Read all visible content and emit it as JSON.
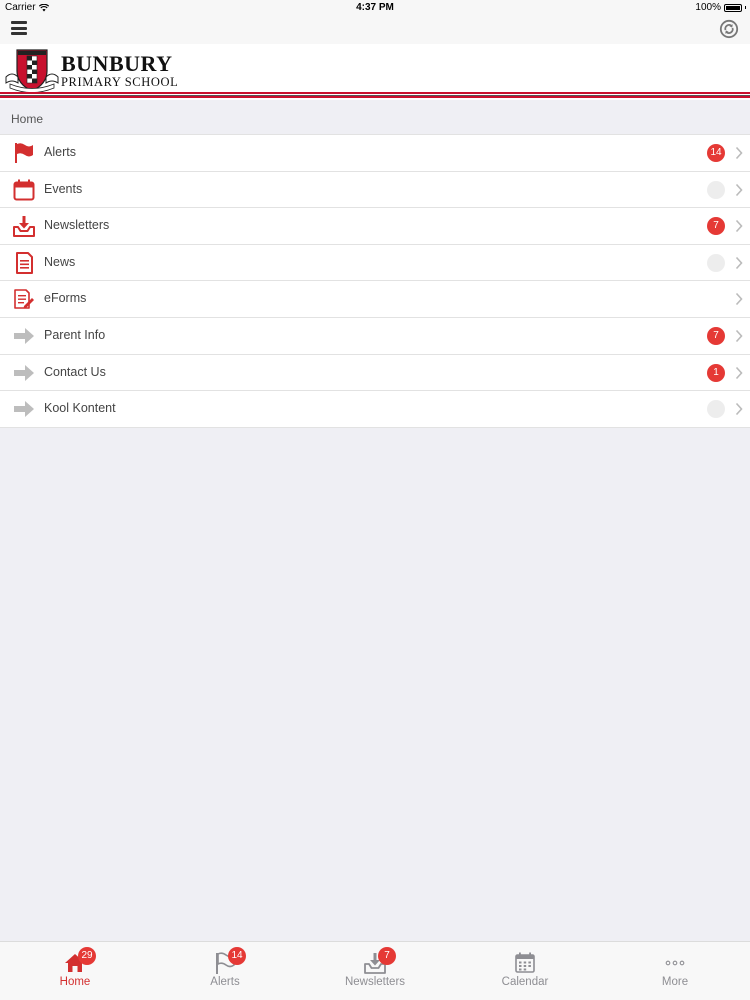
{
  "status_bar": {
    "carrier": "Carrier",
    "time": "4:37 PM",
    "battery": "100%"
  },
  "header": {
    "school_line1": "BUNBURY",
    "school_line2": "PRIMARY SCHOOL"
  },
  "breadcrumb": "Home",
  "menu": [
    {
      "label": "Alerts",
      "badge": "14",
      "icon": "flag-icon"
    },
    {
      "label": "Events",
      "badge": "",
      "icon": "calendar-icon"
    },
    {
      "label": "Newsletters",
      "badge": "7",
      "icon": "download-tray-icon"
    },
    {
      "label": "News",
      "badge": "",
      "icon": "document-icon"
    },
    {
      "label": "eForms",
      "badge": null,
      "icon": "form-edit-icon"
    },
    {
      "label": "Parent Info",
      "badge": "7",
      "icon": "arrow-right-icon"
    },
    {
      "label": "Contact Us",
      "badge": "1",
      "icon": "arrow-right-icon"
    },
    {
      "label": "Kool Kontent",
      "badge": "",
      "icon": "arrow-right-icon"
    }
  ],
  "tabs": [
    {
      "label": "Home",
      "badge": "29",
      "icon": "home-icon",
      "active": true
    },
    {
      "label": "Alerts",
      "badge": "14",
      "icon": "flag-icon"
    },
    {
      "label": "Newsletters",
      "badge": "7",
      "icon": "download-tray-icon"
    },
    {
      "label": "Calendar",
      "badge": null,
      "icon": "calendar-icon"
    },
    {
      "label": "More",
      "badge": null,
      "icon": "more-icon"
    }
  ],
  "colors": {
    "accent": "#e53935",
    "brand_red": "#c8102e",
    "inactive": "#8e8e93"
  }
}
